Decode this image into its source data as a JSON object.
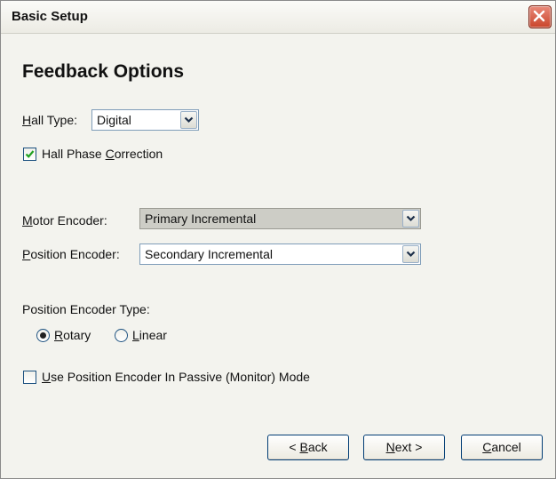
{
  "window": {
    "title": "Basic Setup"
  },
  "page": {
    "heading": "Feedback Options"
  },
  "hall_type": {
    "label_mnemonic": "H",
    "label_rest": "all Type:",
    "value": "Digital"
  },
  "hall_phase_correction": {
    "label_pre": "Hall Phase ",
    "label_mnemonic": "C",
    "label_rest": "orrection",
    "checked": true
  },
  "motor_encoder": {
    "label_mnemonic": "M",
    "label_rest": "otor Encoder:",
    "value": "Primary Incremental",
    "enabled": false
  },
  "position_encoder": {
    "label_mnemonic": "P",
    "label_rest": "osition Encoder:",
    "value": "Secondary Incremental"
  },
  "position_encoder_type": {
    "label": "Position Encoder Type:",
    "options": [
      {
        "mnemonic": "R",
        "rest": "otary",
        "selected": true
      },
      {
        "mnemonic": "L",
        "rest": "inear",
        "selected": false
      }
    ]
  },
  "passive_mode": {
    "label_mnemonic": "U",
    "label_rest": "se Position Encoder In Passive (Monitor) Mode",
    "checked": false
  },
  "buttons": {
    "back": {
      "pre": "< ",
      "mnemonic": "B",
      "rest": "ack"
    },
    "next": {
      "pre": "",
      "mnemonic": "N",
      "rest": "ext >"
    },
    "cancel": {
      "pre": "",
      "mnemonic": "C",
      "rest": "ancel"
    }
  },
  "icons": {
    "close": "close-icon",
    "dropdown": "chevron-down-icon",
    "check": "check-icon"
  }
}
